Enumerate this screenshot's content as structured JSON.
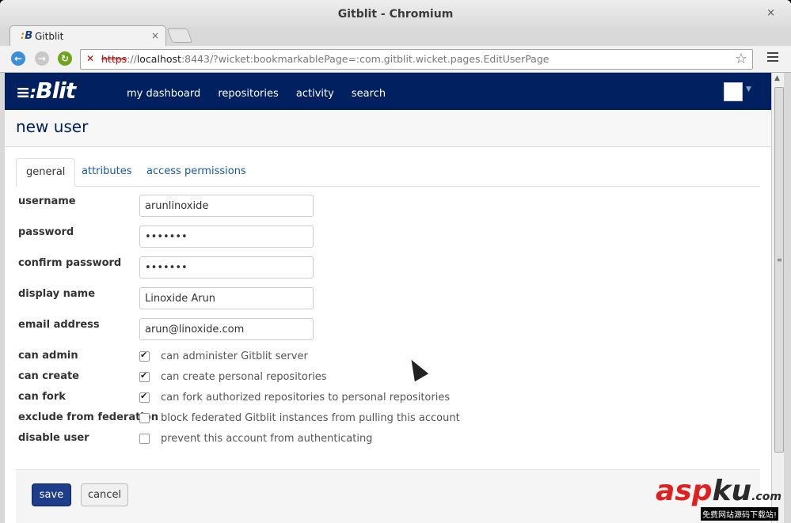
{
  "window": {
    "title": "Gitblit - Chromium",
    "close": "×"
  },
  "tab": {
    "title": "Gitblit",
    "close": "×"
  },
  "address": {
    "scheme": "https",
    "sep": "://",
    "host": "localhost",
    "rest": ":8443/?wicket:bookmarkablePage=:com.gitblit.wicket.pages.EditUserPage"
  },
  "brand": {
    "prefix": "≡:",
    "name": "Blit"
  },
  "nav": {
    "items": [
      "my dashboard",
      "repositories",
      "activity",
      "search"
    ]
  },
  "page": {
    "title": "new user"
  },
  "tabs": [
    "general",
    "attributes",
    "access permissions"
  ],
  "form": {
    "fields": [
      {
        "label": "username",
        "value": "arunlinoxide"
      },
      {
        "label": "password",
        "value": "•••••••"
      },
      {
        "label": "confirm password",
        "value": "•••••••"
      },
      {
        "label": "display name",
        "value": "Linoxide Arun"
      },
      {
        "label": "email address",
        "value": "arun@linoxide.com"
      }
    ],
    "checks": [
      {
        "label": "can admin",
        "checked": true,
        "desc": "can administer Gitblit server"
      },
      {
        "label": "can create",
        "checked": true,
        "desc": "can create personal repositories"
      },
      {
        "label": "can fork",
        "checked": true,
        "desc": "can fork authorized repositories to personal repositories"
      },
      {
        "label": "exclude from federation",
        "checked": false,
        "desc": "block federated Gitblit instances from pulling this account"
      },
      {
        "label": "disable user",
        "checked": false,
        "desc": "prevent this account from authenticating"
      }
    ]
  },
  "buttons": {
    "save": "save",
    "cancel": "cancel"
  },
  "watermark": {
    "asp": "asp",
    "ku": "ku",
    "com": ".com",
    "sub": "免费网站源码下载站!"
  }
}
